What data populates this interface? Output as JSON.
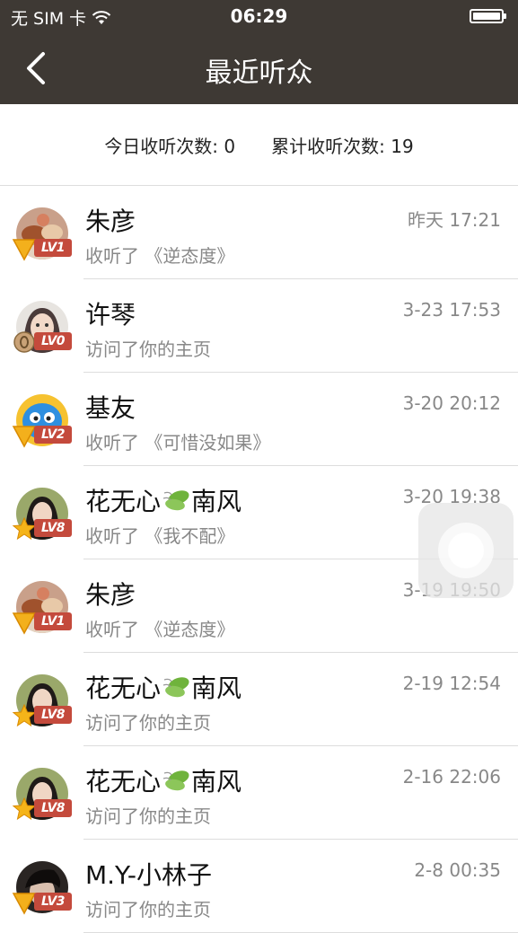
{
  "status_bar": {
    "carrier": "无 SIM 卡",
    "time": "06:29"
  },
  "nav": {
    "title": "最近听众"
  },
  "stats": {
    "today": "今日收听次数: 0",
    "total": "累计收听次数: 19"
  },
  "colors": {
    "header_bg": "#3e3934",
    "badge_red": "#c44a3c"
  },
  "listeners": [
    {
      "name": "朱彦",
      "action": "收听了 《逆态度》",
      "time": "昨天 17:21",
      "level": "LV1",
      "badge": "triangle-medal-icon",
      "avatar": "food-avatar"
    },
    {
      "name": "许琴",
      "action": "访问了你的主页",
      "time": "3-23 17:53",
      "level": "LV0",
      "badge": "coin-medal-icon",
      "avatar": "girl-avatar"
    },
    {
      "name": "基友",
      "action": "收听了 《可惜没如果》",
      "time": "3-20 20:12",
      "level": "LV2",
      "badge": "triangle-medal-icon",
      "avatar": "cartoon-bird-avatar"
    },
    {
      "name_parts": [
        "花无心",
        "南风"
      ],
      "action": "收听了 《我不配》",
      "time": "3-20 19:38",
      "level": "LV8",
      "badge": "star-medal-icon",
      "avatar": "girl-photo-avatar"
    },
    {
      "name": "朱彦",
      "action": "收听了 《逆态度》",
      "time": "3-19 19:50",
      "level": "LV1",
      "badge": "triangle-medal-icon",
      "avatar": "food-avatar"
    },
    {
      "name_parts": [
        "花无心",
        "南风"
      ],
      "action": "访问了你的主页",
      "time": "2-19 12:54",
      "level": "LV8",
      "badge": "star-medal-icon",
      "avatar": "girl-photo-avatar"
    },
    {
      "name_parts": [
        "花无心",
        "南风"
      ],
      "action": "访问了你的主页",
      "time": "2-16 22:06",
      "level": "LV8",
      "badge": "star-medal-icon",
      "avatar": "girl-photo-avatar"
    },
    {
      "name": "M.Y-小林子",
      "action": "访问了你的主页",
      "time": "2-8 00:35",
      "level": "LV3",
      "badge": "triangle-medal-icon",
      "avatar": "dark-avatar"
    }
  ]
}
